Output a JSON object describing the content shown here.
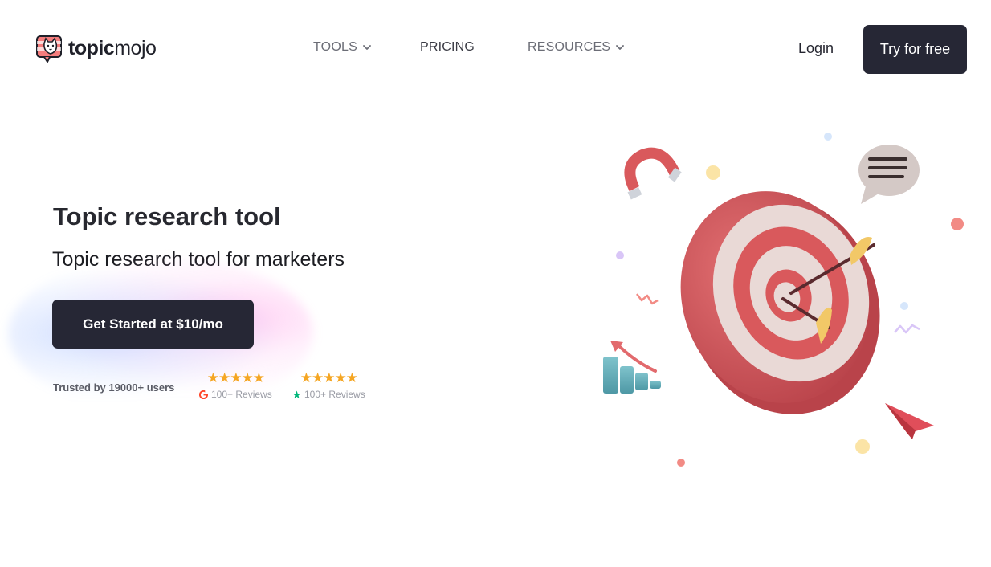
{
  "brand": {
    "name_bold": "topic",
    "name_light": "mojo"
  },
  "nav": {
    "tools": "TOOLS",
    "pricing": "PRICING",
    "resources": "RESOURCES"
  },
  "header": {
    "login": "Login",
    "try_free": "Try for free"
  },
  "hero": {
    "title": "Topic research tool",
    "subtitle": "Topic research tool for marketers",
    "cta": "Get Started at $10/mo",
    "trusted": "Trusted by 19000+ users"
  },
  "ratings": {
    "g2": {
      "stars": "★★★★★",
      "reviews": "100+ Reviews",
      "icon": "g2-icon"
    },
    "trustpilot": {
      "stars": "★★★★★",
      "reviews": "100+ Reviews",
      "icon": "trustpilot-star-icon"
    }
  },
  "colors": {
    "button_dark": "#262735",
    "star": "#f5a623",
    "target_red": "#d9595c",
    "trustpilot_green": "#00b67a",
    "g2_red": "#ff492c"
  }
}
